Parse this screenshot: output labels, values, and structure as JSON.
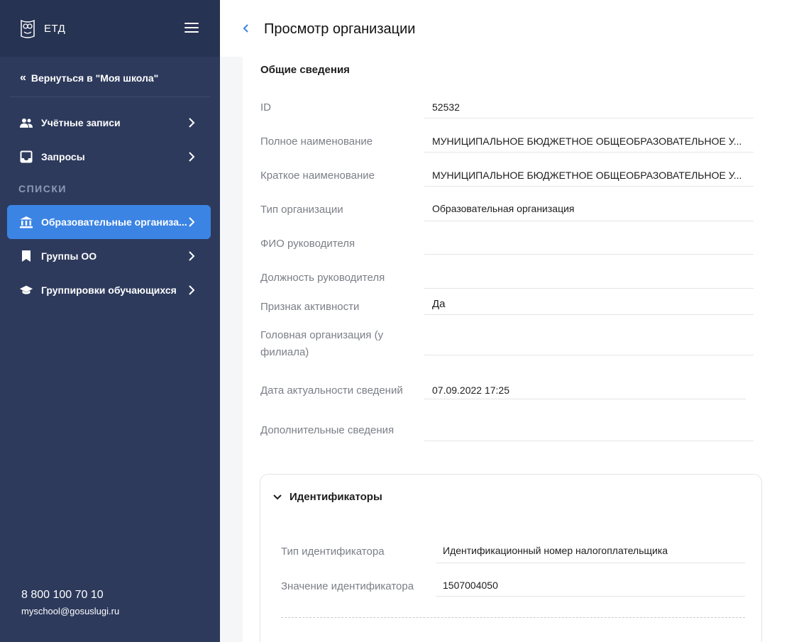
{
  "sidebar": {
    "logo_text": "ЕТД",
    "back_label": "Вернуться в \"Моя школа\"",
    "items": [
      {
        "label": "Учётные записи",
        "icon": "users-icon"
      },
      {
        "label": "Запросы",
        "icon": "inbox-icon"
      }
    ],
    "section_title": "СПИСКИ",
    "list_items": [
      {
        "label": "Образовательные организа...",
        "icon": "institution-icon",
        "active": true
      },
      {
        "label": "Группы ОО",
        "icon": "bookmark-icon",
        "active": false
      },
      {
        "label": "Группировки обучающихся",
        "icon": "graduation-cap-icon",
        "active": false
      }
    ],
    "phone": "8 800 100 70 10",
    "email": "myschool@gosuslugi.ru"
  },
  "header": {
    "title": "Просмотр организации"
  },
  "general": {
    "heading": "Общие сведения",
    "fields": [
      {
        "label": "ID",
        "value": "52532"
      },
      {
        "label": "Полное наименование",
        "value": "МУНИЦИПАЛЬНОЕ БЮДЖЕТНОЕ ОБЩЕОБРАЗОВАТЕЛЬНОЕ У..."
      },
      {
        "label": "Краткое наименование",
        "value": "МУНИЦИПАЛЬНОЕ БЮДЖЕТНОЕ ОБЩЕОБРАЗОВАТЕЛЬНОЕ У..."
      },
      {
        "label": "Тип организации",
        "value": "Образовательная организация"
      },
      {
        "label": "ФИО руководителя",
        "value": ""
      },
      {
        "label": "Должность руководителя",
        "value": ""
      },
      {
        "label": "Признак активности",
        "value": "Да"
      },
      {
        "label": "Головная организация (у филиала)",
        "value": ""
      },
      {
        "label": "Дата актуальности сведений",
        "value": "07.09.2022 17:25"
      },
      {
        "label": "Дополнительные сведения",
        "value": ""
      }
    ]
  },
  "identifiers": {
    "title": "Идентификаторы",
    "fields": [
      {
        "label": "Тип идентификатора",
        "value": "Идентификационный номер налогоплательщика"
      },
      {
        "label": "Значение идентификатора",
        "value": "1507004050"
      }
    ]
  },
  "colors": {
    "sidebar_bg": "#2d3a5c",
    "active_item": "#3b84e4",
    "accent": "#3b84e4"
  }
}
